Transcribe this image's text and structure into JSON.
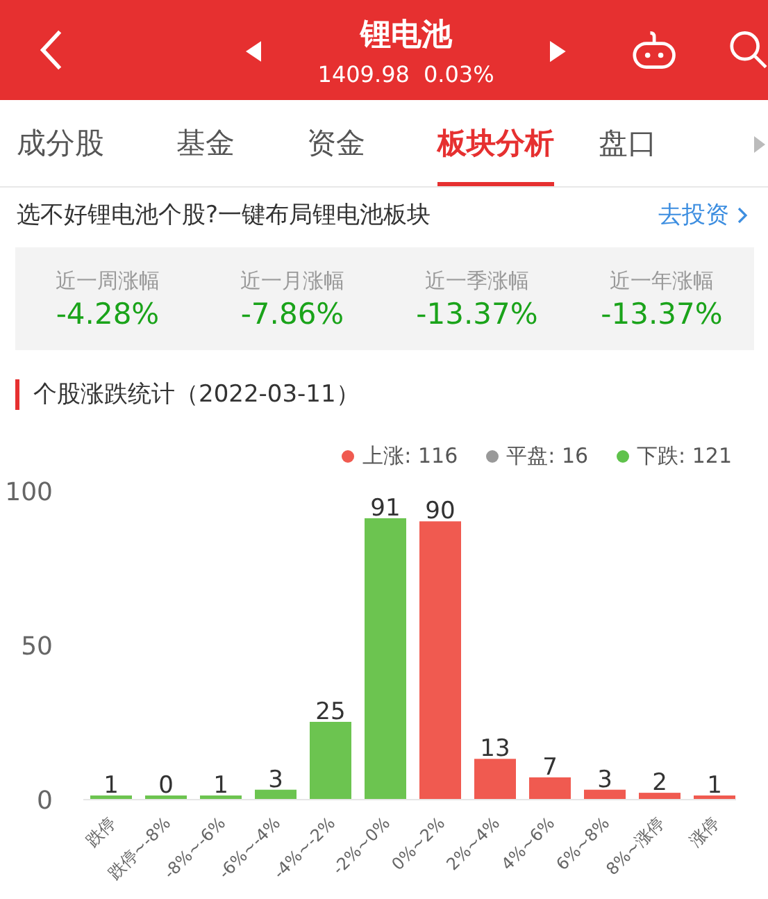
{
  "header": {
    "title": "锂电池",
    "price": "1409.98",
    "change": "0.03%"
  },
  "tabs": [
    {
      "label": "成分股",
      "selected": false
    },
    {
      "label": "基金",
      "selected": false
    },
    {
      "label": "资金",
      "selected": false
    },
    {
      "label": "板块分析",
      "selected": true
    },
    {
      "label": "盘口",
      "selected": false
    }
  ],
  "promo": {
    "text": "选不好锂电池个股?一键布局锂电池板块",
    "link": "去投资"
  },
  "stats": [
    {
      "label": "近一周涨幅",
      "value": "-4.28%"
    },
    {
      "label": "近一月涨幅",
      "value": "-7.86%"
    },
    {
      "label": "近一季涨幅",
      "value": "-13.37%"
    },
    {
      "label": "近一年涨幅",
      "value": "-13.37%"
    }
  ],
  "section_title": "个股涨跌统计（2022-03-11）",
  "legend": [
    {
      "label": "上涨: 116",
      "color": "#f05a50"
    },
    {
      "label": "平盘: 16",
      "color": "#999999"
    },
    {
      "label": "下跌: 121",
      "color": "#5fc24b"
    }
  ],
  "chart_data": {
    "type": "bar",
    "categories": [
      "跌停",
      "跌停~-8%",
      "-8%~-6%",
      "-6%~-4%",
      "-4%~-2%",
      "-2%~0%",
      "0%~2%",
      "2%~4%",
      "4%~6%",
      "6%~8%",
      "8%~涨停",
      "涨停"
    ],
    "series": [
      {
        "color": "#6cc450",
        "values": [
          1,
          0,
          1,
          3,
          25,
          91,
          null,
          null,
          null,
          null,
          null,
          null
        ]
      },
      {
        "color": "#f05a50",
        "values": [
          null,
          null,
          null,
          null,
          null,
          null,
          90,
          13,
          7,
          3,
          2,
          1
        ]
      }
    ],
    "ylim": [
      0,
      100
    ],
    "yticks": [
      0,
      50,
      100
    ],
    "data_labels": true
  }
}
